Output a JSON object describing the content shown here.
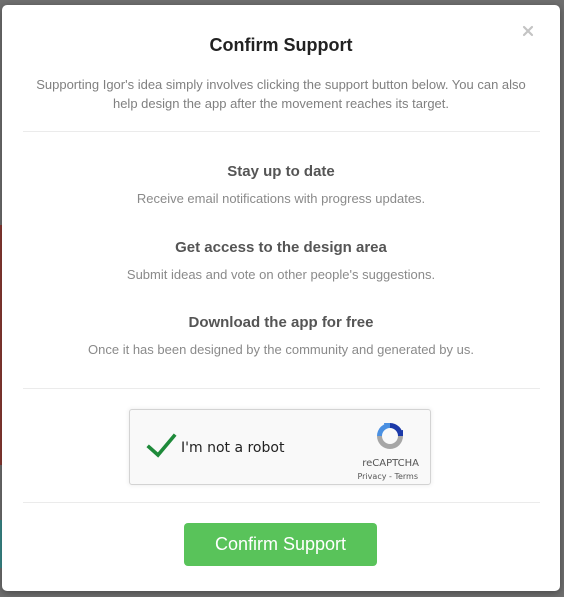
{
  "modal": {
    "title": "Confirm Support",
    "intro": "Supporting Igor's idea simply involves clicking the support button below. You can also help design the app after the movement reaches its target.",
    "close_icon": "close-icon"
  },
  "features": [
    {
      "heading": "Stay up to date",
      "description": "Receive email notifications with progress updates."
    },
    {
      "heading": "Get access to the design area",
      "description": "Submit ideas and vote on other people's suggestions."
    },
    {
      "heading": "Download the app for free",
      "description": "Once it has been designed by the community and generated by us."
    }
  ],
  "recaptcha": {
    "checked": true,
    "label": "I'm not a robot",
    "brand": "reCAPTCHA",
    "privacy": "Privacy",
    "separator": " - ",
    "terms": "Terms",
    "check_icon": "checkmark-icon",
    "logo_icon": "recaptcha-logo-icon"
  },
  "actions": {
    "confirm_label": "Confirm Support"
  },
  "colors": {
    "confirm_button": "#59c35a",
    "checkmark": "#1e8a3a",
    "title": "#222222",
    "muted_text": "#808080"
  }
}
